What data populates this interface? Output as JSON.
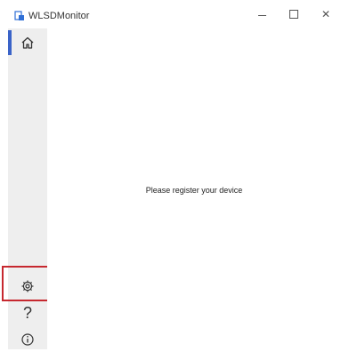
{
  "window": {
    "title": "WLSDMonitor",
    "minimize_label": "—",
    "close_label": "✕"
  },
  "sidebar": {
    "items": [
      {
        "name": "home",
        "icon": "home-icon",
        "selected": true
      },
      {
        "name": "settings",
        "icon": "gear-icon",
        "highlighted": true
      },
      {
        "name": "help",
        "icon": "question-mark-icon",
        "glyph": "?"
      },
      {
        "name": "about",
        "icon": "info-icon"
      }
    ]
  },
  "main": {
    "message": "Please register your device"
  },
  "colors": {
    "accent": "#3a63c8",
    "highlight_border": "#c6282f",
    "sidebar_bg": "#eeeeee"
  }
}
